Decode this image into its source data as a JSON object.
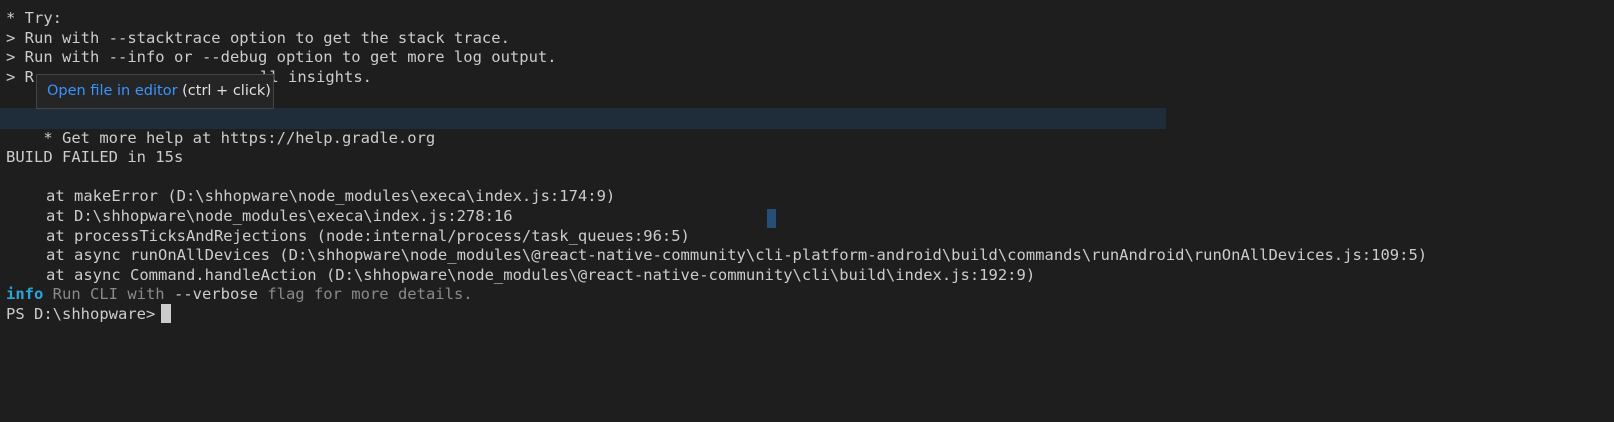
{
  "terminal": {
    "lines": [
      "* Try:",
      "> Run with --stacktrace option to get the stack trace.",
      "> Run with --info or --debug option to get more log output.",
      "> R",
      "ll insights.",
      "* Get more help at https://help.gradle.org",
      "BUILD FAILED in 15s",
      "at makeError (D:\\shhopware\\node_modules\\execa\\index.js:174:9)",
      "at D:\\shhopware\\node_modules\\execa\\index.js:278:16",
      "at processTicksAndRejections (node:internal/process/task_queues:96:5)",
      "at async runOnAllDevices (D:\\shhopware\\node_modules\\@react-native-community\\cli-platform-android\\build\\commands\\runAndroid\\runOnAllDevices.js:109:5)",
      "at async Command.handleAction (D:\\shhopware\\node_modules\\@react-native-community\\cli\\build\\index.js:192:9)"
    ],
    "info_line": {
      "label": "info",
      "text_before": " Run CLI with ",
      "flag": "--verbose",
      "text_after": " flag for more details."
    },
    "prompt": "PS D:\\shhopware>"
  },
  "tooltip": {
    "link_label": "Open file in editor",
    "hint": " (ctrl + click)"
  },
  "colors": {
    "background": "#1e1e1e",
    "text": "#cccccc",
    "info": "#27a7d8",
    "link": "#3794ff",
    "highlight_row": "#1f2d3b"
  }
}
